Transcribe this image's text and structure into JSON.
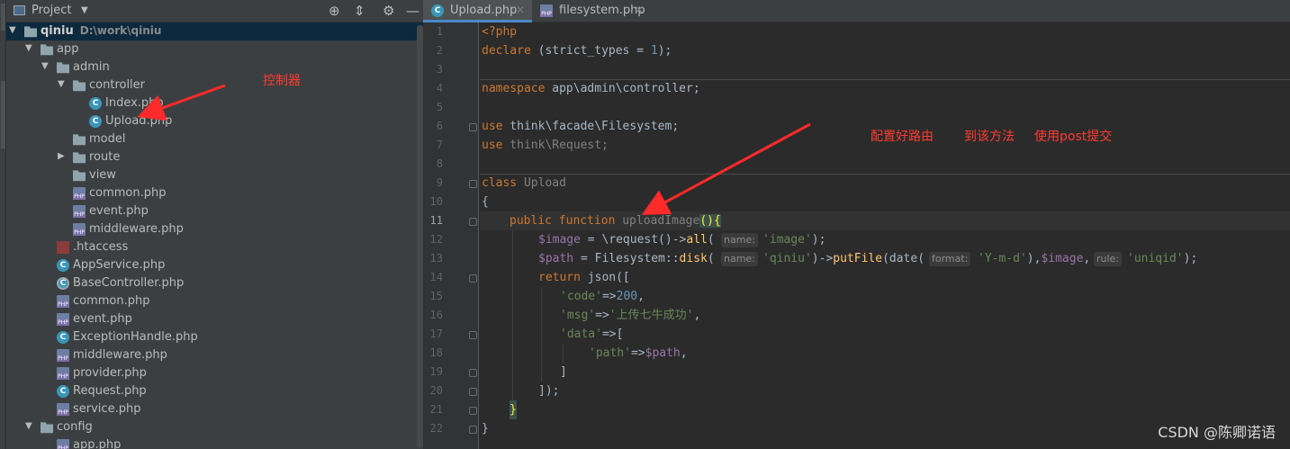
{
  "project_panel": {
    "title": "Project",
    "tree": [
      {
        "label": "qiniu",
        "sub": "D:\\work\\qiniu",
        "type": "folder",
        "level": 0,
        "expanded": true,
        "bold": true
      },
      {
        "label": "app",
        "type": "folder",
        "level": 1,
        "expanded": true
      },
      {
        "label": "admin",
        "type": "folder",
        "level": 2,
        "expanded": true
      },
      {
        "label": "controller",
        "type": "folder",
        "level": 3,
        "expanded": true
      },
      {
        "label": "Index.php",
        "type": "class",
        "level": 4
      },
      {
        "label": "Upload.php",
        "type": "class",
        "level": 4
      },
      {
        "label": "model",
        "type": "folder",
        "level": 3
      },
      {
        "label": "route",
        "type": "folder",
        "level": 3,
        "collapsed": true
      },
      {
        "label": "view",
        "type": "folder",
        "level": 3
      },
      {
        "label": "common.php",
        "type": "php",
        "level": 3
      },
      {
        "label": "event.php",
        "type": "php",
        "level": 3
      },
      {
        "label": "middleware.php",
        "type": "php",
        "level": 3
      },
      {
        "label": ".htaccess",
        "type": "htaccess",
        "level": 2
      },
      {
        "label": "AppService.php",
        "type": "class",
        "level": 2
      },
      {
        "label": "BaseController.php",
        "type": "abstract",
        "level": 2
      },
      {
        "label": "common.php",
        "type": "php",
        "level": 2
      },
      {
        "label": "event.php",
        "type": "php",
        "level": 2
      },
      {
        "label": "ExceptionHandle.php",
        "type": "class",
        "level": 2
      },
      {
        "label": "middleware.php",
        "type": "php",
        "level": 2
      },
      {
        "label": "provider.php",
        "type": "php",
        "level": 2
      },
      {
        "label": "Request.php",
        "type": "class",
        "level": 2
      },
      {
        "label": "service.php",
        "type": "php",
        "level": 2
      },
      {
        "label": "config",
        "type": "folder",
        "level": 1,
        "expanded": true
      },
      {
        "label": "app.php",
        "type": "php",
        "level": 2
      }
    ]
  },
  "editor": {
    "tabs": [
      {
        "label": "Upload.php",
        "active": true,
        "icon": "class-icon"
      },
      {
        "label": "filesystem.php",
        "active": false,
        "icon": "php-file-icon"
      }
    ],
    "line_numbers": [
      "1",
      "2",
      "3",
      "4",
      "5",
      "6",
      "7",
      "8",
      "9",
      "10",
      "11",
      "12",
      "13",
      "14",
      "15",
      "16",
      "17",
      "18",
      "19",
      "20",
      "21",
      "22"
    ],
    "current_line": "11",
    "code": {
      "l1": "<?php",
      "l2_kw": "declare",
      "l2_a": " (strict_types = ",
      "l2_num": "1",
      "l2_b": ");",
      "l4_kw": "namespace",
      "l4_rest": " app\\admin\\controller;",
      "l6_kw": "use",
      "l6_rest": " think\\facade\\Filesystem;",
      "l7_kw": "use",
      "l7_rest": " think\\Request;",
      "l9_kw": "class",
      "l9_name": " Upload",
      "l10": "{",
      "l11_kw": "public function",
      "l11_name": "uploadImage",
      "l11_paren": "()",
      "l11_brace": "{",
      "l12_var": "$image",
      "l12_a": " = \\request()->",
      "l12_fn": "all",
      "l12_b": "(",
      "l12_hint": "name:",
      "l12_str": "'image'",
      "l12_c": ");",
      "l13_var": "$path",
      "l13_a": " = Filesystem::",
      "l13_fn": "disk",
      "l13_b": "(",
      "l13_hint": "name:",
      "l13_str": "'qiniu'",
      "l13_c": ")->",
      "l13_fn2": "putFile",
      "l13_d": "(date(",
      "l13_hint2": "format:",
      "l13_str2": "'Y-m-d'",
      "l13_e": "),",
      "l13_var2": "$image",
      "l13_f": ",",
      "l13_hint3": "rule:",
      "l13_str3": "'uniqid'",
      "l13_g": ");",
      "l14_kw": "return",
      "l14_rest": " json([",
      "l15_str": "'code'",
      "l15_a": "=>",
      "l15_num": "200",
      "l15_b": ",",
      "l16_str": "'msg'",
      "l16_a": "=>",
      "l16_str2": "'上传七牛成功'",
      "l16_b": ",",
      "l17_str": "'data'",
      "l17_a": "=>[",
      "l18_str": "'path'",
      "l18_a": "=>",
      "l18_var": "$path",
      "l18_b": ",",
      "l19": "]",
      "l20": "]);",
      "l21": "}",
      "l22": "}"
    }
  },
  "annotations": {
    "controller_note": "控制器",
    "route_note": "配置好路由",
    "method_note": "到该方法",
    "post_note": "使用post提交"
  },
  "watermark": "CSDN @陈卿诺语",
  "colors": {
    "annotation": "#ff3b30",
    "panel_bg": "#3c3f41",
    "editor_bg": "#2b2b2b",
    "keyword": "#cc7832",
    "string": "#6a8759",
    "variable": "#9876aa"
  }
}
